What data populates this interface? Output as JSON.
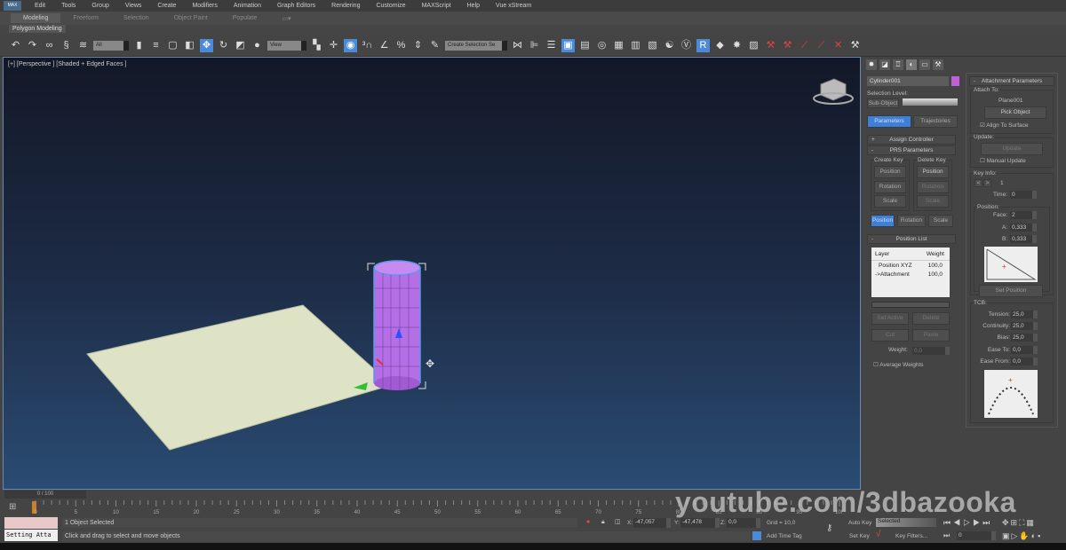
{
  "menu": {
    "logo": "MAX",
    "items": [
      "Edit",
      "Tools",
      "Group",
      "Views",
      "Create",
      "Modifiers",
      "Animation",
      "Graph Editors",
      "Rendering",
      "Customize",
      "MAXScript",
      "Help",
      "Vue xStream"
    ]
  },
  "ribbon": {
    "tabs": [
      "Modeling",
      "Freeform",
      "Selection",
      "Object Paint",
      "Populate"
    ],
    "sub": "Polygon Modeling"
  },
  "toolbar": {
    "filter": "All",
    "refcoord": "View",
    "selset": "Create Selection Se"
  },
  "viewport": {
    "label": "[+] [Perspective ] [Shaded + Edged Faces ]"
  },
  "watermark": "youtube.com/3dbazooka",
  "command": {
    "object_name": "Cylinder001",
    "object_color": "#c060d8",
    "selection_level": "Selection Level:",
    "sub_object": "Sub-Object",
    "tabs": [
      "Parameters",
      "Trajectories"
    ],
    "assign_controller": "Assign Controller",
    "prs": "PRS Parameters",
    "create_key": "Create Key",
    "delete_key": "Delete Key",
    "create_buttons": [
      "Position",
      "Rotation",
      "Scale"
    ],
    "delete_buttons": [
      "Position",
      "Rotation",
      "Scale"
    ],
    "prs_tabs": [
      "Position",
      "Rotation",
      "Scale"
    ],
    "position_list": "Position List",
    "list_headers": [
      "Layer",
      "Weight"
    ],
    "list_rows": [
      [
        "Position XYZ",
        "100,0"
      ],
      [
        "->Attachment",
        "100,0"
      ]
    ],
    "set_active": "Set Active",
    "delete": "Delete",
    "cut": "Cut",
    "paste": "Paste",
    "weight_label": "Weight:",
    "weight_value": "0,0",
    "average_weights": "Average Weights"
  },
  "attachment": {
    "title": "Attachment Parameters",
    "attach_to": "Attach To:",
    "target": "Plane001",
    "pick_object": "Pick Object",
    "align": "Align To Surface",
    "update_group": "Update:",
    "update": "Update",
    "manual_update": "Manual Update",
    "key_info": "Key Info:",
    "key_number": "1",
    "time_label": "Time:",
    "time": "0",
    "position_group": "Position:",
    "face_label": "Face:",
    "face": "2",
    "a_label": "A:",
    "a": "0,333",
    "b_label": "B:",
    "b": "0,333",
    "set_position": "Set Position",
    "tcb": "TCB:",
    "tension_label": "Tension:",
    "tension": "25,0",
    "continuity_label": "Continuity:",
    "continuity": "25,0",
    "bias_label": "Bias:",
    "bias": "25,0",
    "ease_to_label": "Ease To:",
    "ease_to": "0,0",
    "ease_from_label": "Ease From:",
    "ease_from": "0,0"
  },
  "timeline": {
    "frame": "0 / 100",
    "ticks": [
      "0",
      "5",
      "10",
      "15",
      "20",
      "25",
      "30",
      "35",
      "40",
      "45",
      "50",
      "55",
      "60",
      "65",
      "70",
      "75",
      "80",
      "85",
      "90",
      "95",
      "100"
    ]
  },
  "status": {
    "script": "Setting Atta",
    "selected": "1 Object Selected",
    "prompt": "Click and drag to select and move objects",
    "x_label": "X:",
    "x": "-47,057",
    "y_label": "Y:",
    "y": "-47,478",
    "z_label": "Z:",
    "z": "0,0",
    "grid": "Grid = 10,0",
    "add_time_tag": "Add Time Tag",
    "auto_key": "Auto Key",
    "auto_mode": "Selected",
    "set_key": "Set Key",
    "key_filters": "Key Filters...",
    "frame": "0"
  }
}
